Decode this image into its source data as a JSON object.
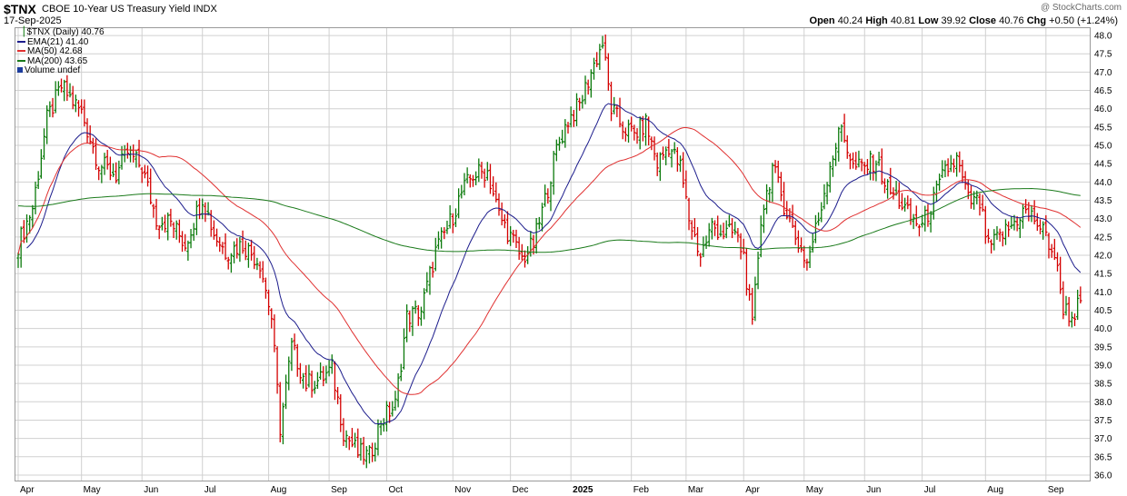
{
  "header": {
    "symbol": "$TNX",
    "title": "CBOE 10-Year US Treasury Yield",
    "exchange": "INDX",
    "date": "17-Sep-2025",
    "watermark": "@ StockCharts.com",
    "open_label": "Open",
    "open": "40.24",
    "high_label": "High",
    "high": "40.81",
    "low_label": "Low",
    "low": "39.92",
    "close_label": "Close",
    "close": "40.76",
    "chg_label": "Chg",
    "chg": "+0.50 (+1.24%)"
  },
  "legend": {
    "price": "$TNX (Daily) 40.76",
    "ema21": "EMA(21) 41.40",
    "ma50": "MA(50) 42.68",
    "ma200": "MA(200) 43.65",
    "volume": "Volume undef"
  },
  "colors": {
    "up": "#0b7a0b",
    "down": "#d40000",
    "ema": "#1c1c8c",
    "ma50": "#e03030",
    "ma200": "#1a7a1a",
    "grid": "#d0d0d0"
  },
  "chart_data": {
    "type": "ohlc-bar",
    "ylim": [
      35.85,
      48.2
    ],
    "yticks": [
      "36.0",
      "36.5",
      "37.0",
      "37.5",
      "38.0",
      "38.5",
      "39.0",
      "39.5",
      "40.0",
      "40.5",
      "41.0",
      "41.5",
      "42.0",
      "42.5",
      "43.0",
      "43.5",
      "44.0",
      "44.5",
      "45.0",
      "45.5",
      "46.0",
      "46.5",
      "47.0",
      "47.5",
      "48.0"
    ],
    "xlabels": [
      {
        "label": "Apr",
        "day": 0
      },
      {
        "label": "May",
        "day": 22
      },
      {
        "label": "Jun",
        "day": 43
      },
      {
        "label": "Jul",
        "day": 64
      },
      {
        "label": "Aug",
        "day": 87
      },
      {
        "label": "Sep",
        "day": 108
      },
      {
        "label": "Oct",
        "day": 128
      },
      {
        "label": "Nov",
        "day": 151
      },
      {
        "label": "Dec",
        "day": 171
      },
      {
        "label": "2025",
        "day": 192
      },
      {
        "label": "Feb",
        "day": 213
      },
      {
        "label": "Mar",
        "day": 232
      },
      {
        "label": "Apr",
        "day": 252
      },
      {
        "label": "May",
        "day": 273
      },
      {
        "label": "Jun",
        "day": 294
      },
      {
        "label": "Jul",
        "day": 314
      },
      {
        "label": "Aug",
        "day": 336
      },
      {
        "label": "Sep",
        "day": 357
      }
    ],
    "total_days": 370,
    "closes": [
      {
        "d": 0,
        "c": 42.3
      },
      {
        "d": 5,
        "c": 43.3
      },
      {
        "d": 10,
        "c": 45.7
      },
      {
        "d": 15,
        "c": 46.6
      },
      {
        "d": 22,
        "c": 45.9
      },
      {
        "d": 28,
        "c": 44.5
      },
      {
        "d": 34,
        "c": 44.2
      },
      {
        "d": 38,
        "c": 44.8
      },
      {
        "d": 43,
        "c": 44.4
      },
      {
        "d": 48,
        "c": 43.0
      },
      {
        "d": 53,
        "c": 42.9
      },
      {
        "d": 58,
        "c": 42.3
      },
      {
        "d": 64,
        "c": 43.6
      },
      {
        "d": 68,
        "c": 42.6
      },
      {
        "d": 72,
        "c": 42.1
      },
      {
        "d": 78,
        "c": 42.3
      },
      {
        "d": 84,
        "c": 41.8
      },
      {
        "d": 88,
        "c": 40.3
      },
      {
        "d": 91,
        "c": 37.3
      },
      {
        "d": 95,
        "c": 39.5
      },
      {
        "d": 100,
        "c": 38.5
      },
      {
        "d": 105,
        "c": 38.6
      },
      {
        "d": 109,
        "c": 38.9
      },
      {
        "d": 113,
        "c": 37.2
      },
      {
        "d": 118,
        "c": 36.6
      },
      {
        "d": 122,
        "c": 36.5
      },
      {
        "d": 126,
        "c": 37.5
      },
      {
        "d": 131,
        "c": 37.9
      },
      {
        "d": 135,
        "c": 40.3
      },
      {
        "d": 140,
        "c": 40.5
      },
      {
        "d": 145,
        "c": 42.1
      },
      {
        "d": 150,
        "c": 42.9
      },
      {
        "d": 154,
        "c": 43.7
      },
      {
        "d": 158,
        "c": 44.2
      },
      {
        "d": 163,
        "c": 44.3
      },
      {
        "d": 167,
        "c": 43.1
      },
      {
        "d": 171,
        "c": 42.5
      },
      {
        "d": 175,
        "c": 41.9
      },
      {
        "d": 179,
        "c": 42.3
      },
      {
        "d": 183,
        "c": 43.5
      },
      {
        "d": 187,
        "c": 44.9
      },
      {
        "d": 191,
        "c": 45.7
      },
      {
        "d": 195,
        "c": 46.1
      },
      {
        "d": 199,
        "c": 47.0
      },
      {
        "d": 203,
        "c": 47.8
      },
      {
        "d": 206,
        "c": 46.0
      },
      {
        "d": 210,
        "c": 45.5
      },
      {
        "d": 214,
        "c": 45.3
      },
      {
        "d": 218,
        "c": 45.6
      },
      {
        "d": 222,
        "c": 44.5
      },
      {
        "d": 226,
        "c": 45.0
      },
      {
        "d": 230,
        "c": 44.4
      },
      {
        "d": 233,
        "c": 43.0
      },
      {
        "d": 237,
        "c": 42.0
      },
      {
        "d": 241,
        "c": 42.8
      },
      {
        "d": 245,
        "c": 42.6
      },
      {
        "d": 249,
        "c": 42.6
      },
      {
        "d": 252,
        "c": 42.0
      },
      {
        "d": 255,
        "c": 40.0
      },
      {
        "d": 258,
        "c": 43.0
      },
      {
        "d": 262,
        "c": 44.4
      },
      {
        "d": 266,
        "c": 43.4
      },
      {
        "d": 270,
        "c": 42.5
      },
      {
        "d": 274,
        "c": 41.8
      },
      {
        "d": 278,
        "c": 43.0
      },
      {
        "d": 282,
        "c": 44.5
      },
      {
        "d": 286,
        "c": 45.5
      },
      {
        "d": 290,
        "c": 44.4
      },
      {
        "d": 294,
        "c": 44.4
      },
      {
        "d": 298,
        "c": 44.6
      },
      {
        "d": 302,
        "c": 43.8
      },
      {
        "d": 306,
        "c": 43.5
      },
      {
        "d": 310,
        "c": 43.0
      },
      {
        "d": 314,
        "c": 42.8
      },
      {
        "d": 318,
        "c": 43.5
      },
      {
        "d": 322,
        "c": 44.3
      },
      {
        "d": 326,
        "c": 44.6
      },
      {
        "d": 330,
        "c": 43.5
      },
      {
        "d": 334,
        "c": 43.4
      },
      {
        "d": 337,
        "c": 42.2
      },
      {
        "d": 341,
        "c": 42.5
      },
      {
        "d": 345,
        "c": 42.8
      },
      {
        "d": 349,
        "c": 43.2
      },
      {
        "d": 353,
        "c": 43.0
      },
      {
        "d": 357,
        "c": 42.5
      },
      {
        "d": 360,
        "c": 42.0
      },
      {
        "d": 363,
        "c": 40.6
      },
      {
        "d": 366,
        "c": 40.3
      },
      {
        "d": 369,
        "c": 40.76
      }
    ]
  }
}
